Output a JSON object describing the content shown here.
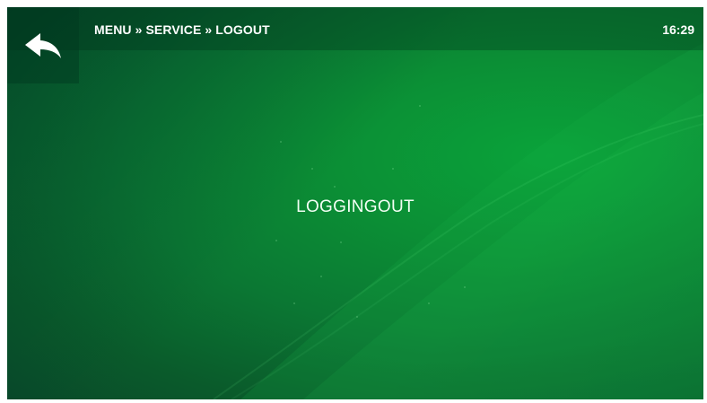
{
  "header": {
    "breadcrumb": "MENU » SERVICE » LOGOUT",
    "time": "16:29"
  },
  "main": {
    "status_message": "LOGGINGOUT"
  },
  "icons": {
    "back": "back-arrow-icon"
  },
  "colors": {
    "background_dark": "#09492a",
    "background_light": "#0aa33a",
    "text": "#ffffff"
  }
}
